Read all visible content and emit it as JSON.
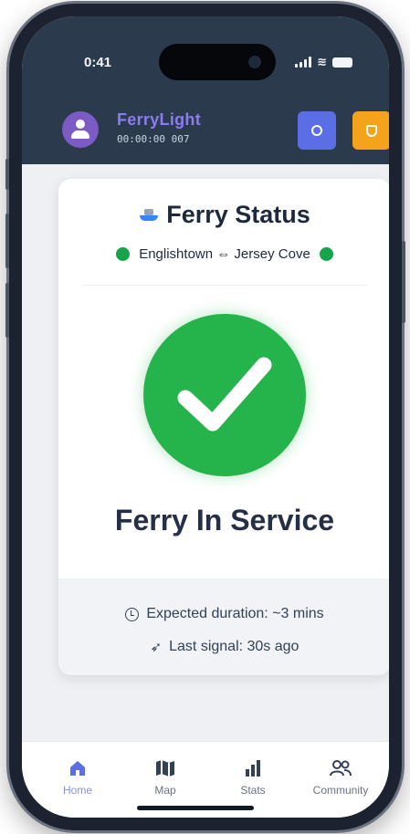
{
  "status_bar": {
    "time": "0:41"
  },
  "header": {
    "app_name": "FerryLight",
    "subtitle": "00:00:00 007",
    "colors": {
      "background": "#2c3a4e",
      "brand": "#8b7cf0",
      "button_a": "#5b6ee6",
      "button_b": "#f5a31a"
    }
  },
  "card": {
    "title": "Ferry Status",
    "route": "Englishtown ⇔ Jersey Cove",
    "status_text": "Ferry In Service",
    "expected_duration": "Expected duration: ~3 mins",
    "last_signal": "Last signal: 30s ago",
    "colors": {
      "status": "#25b34b",
      "route_dot": "#16a34a"
    }
  },
  "nav": {
    "items": [
      {
        "label": "Home",
        "icon": "home-icon",
        "active": true
      },
      {
        "label": "Map",
        "icon": "map-icon",
        "active": false
      },
      {
        "label": "Stats",
        "icon": "stats-icon",
        "active": false
      },
      {
        "label": "Community",
        "icon": "community-icon",
        "active": false
      }
    ]
  }
}
